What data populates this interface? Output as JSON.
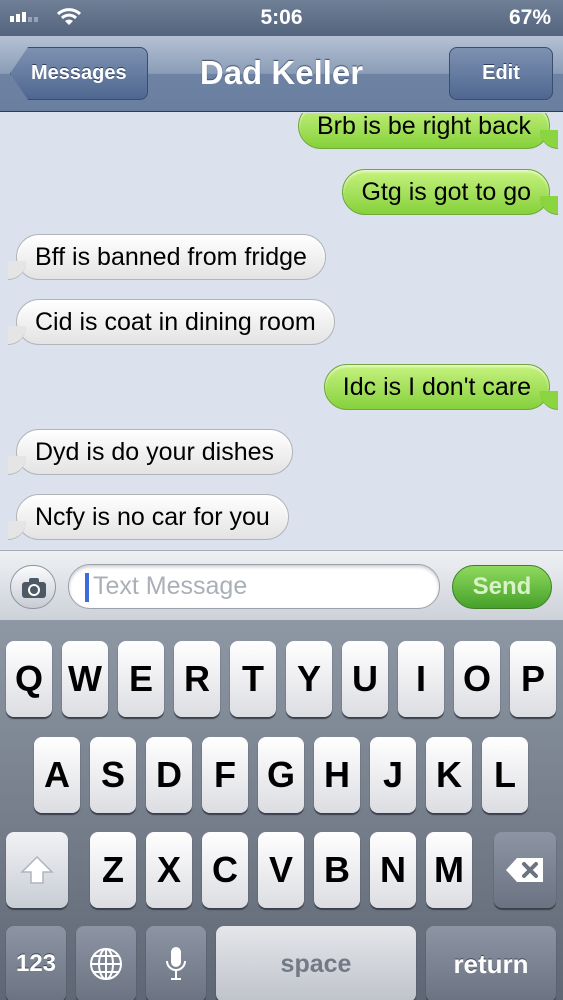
{
  "status_bar": {
    "time": "5:06",
    "battery": "67%"
  },
  "nav": {
    "back_label": "Messages",
    "title": "Dad Keller",
    "edit_label": "Edit"
  },
  "messages": [
    {
      "text": "Brb is be right back",
      "direction": "outgoing"
    },
    {
      "text": "Gtg is got to go",
      "direction": "outgoing"
    },
    {
      "text": "Bff is banned from fridge",
      "direction": "incoming"
    },
    {
      "text": "Cid is coat in dining room",
      "direction": "incoming"
    },
    {
      "text": "Idc is I don't care",
      "direction": "outgoing"
    },
    {
      "text": "Dyd is do your dishes",
      "direction": "incoming"
    },
    {
      "text": "Ncfy is no car for you",
      "direction": "incoming"
    }
  ],
  "composer": {
    "placeholder": "Text Message",
    "send_label": "Send",
    "camera_icon": "camera-icon"
  },
  "keyboard": {
    "row1": [
      "Q",
      "W",
      "E",
      "R",
      "T",
      "Y",
      "U",
      "I",
      "O",
      "P"
    ],
    "row2": [
      "A",
      "S",
      "D",
      "F",
      "G",
      "H",
      "J",
      "K",
      "L"
    ],
    "row3": [
      "Z",
      "X",
      "C",
      "V",
      "B",
      "N",
      "M"
    ],
    "numbers_label": "123",
    "space_label": "space",
    "return_label": "return",
    "icons": {
      "shift": "shift-arrow-icon",
      "delete": "backspace-icon",
      "globe": "globe-icon",
      "mic": "microphone-icon"
    }
  },
  "colors": {
    "outgoing_bubble": "#8ad540",
    "incoming_bubble": "#f2f2f2",
    "nav_bar": "#6e83a3",
    "send": "#46a12a"
  }
}
